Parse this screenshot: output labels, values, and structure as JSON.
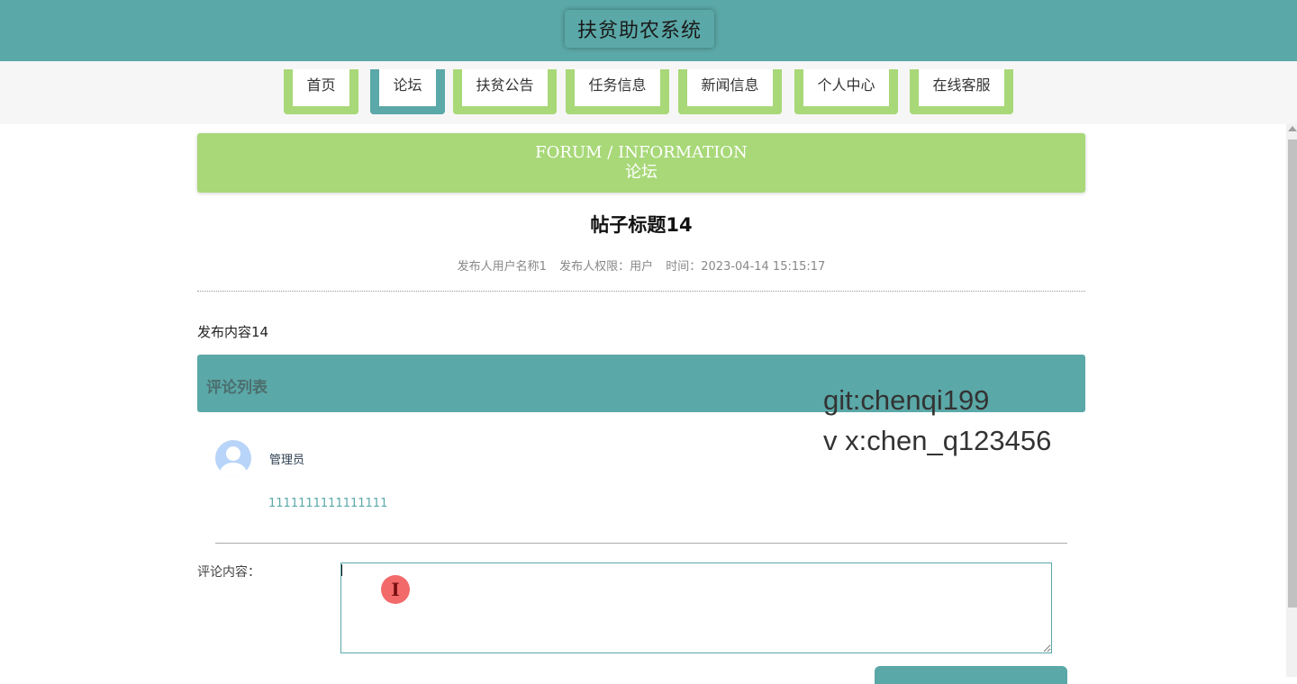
{
  "header": {
    "title": "扶贫助农系统"
  },
  "nav": {
    "items": [
      {
        "label": "首页"
      },
      {
        "label": "论坛"
      },
      {
        "label": "扶贫公告"
      },
      {
        "label": "任务信息"
      },
      {
        "label": "新闻信息"
      },
      {
        "label": "个人中心"
      },
      {
        "label": "在线客服"
      }
    ]
  },
  "banner": {
    "en": "FORUM / INFORMATION",
    "cn": "论坛"
  },
  "post": {
    "title": "帖子标题14",
    "author": "发布人用户名称1",
    "permission": "发布人权限：用户",
    "time": "时间：2023-04-14 15:15:17",
    "content": "发布内容14"
  },
  "comments": {
    "title": "评论列表",
    "items": [
      {
        "user": "管理员",
        "text": "1111111111111111"
      }
    ]
  },
  "form": {
    "label": "评论内容：",
    "value": ""
  },
  "watermark": {
    "line1": "git:chenqi199",
    "line2": "v x:chen_q123456"
  },
  "colors": {
    "teal": "#5ba8a8",
    "green": "#a8d878"
  }
}
